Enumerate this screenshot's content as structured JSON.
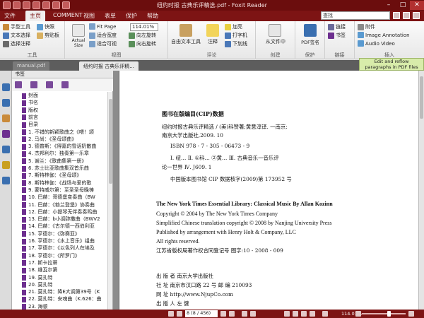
{
  "window": {
    "title": "纽约时报 古典乐评精选.pdf - Foxit Reader",
    "minimize": "–",
    "maximize": "□",
    "close": "✕"
  },
  "menu": {
    "items": [
      "文件",
      "主页",
      "COMMENT",
      "视图",
      "表单",
      "保护",
      "帮助"
    ],
    "active_index": 1,
    "search_placeholder": "查找"
  },
  "ribbon": {
    "tools": {
      "hand": "手型工具",
      "text_select": "文本选择",
      "snapshot": "快照",
      "clipboard": "剪贴板",
      "select_annotation": "选择注释",
      "label": "工具"
    },
    "view": {
      "actual_size": "Actual Size",
      "fit_page": "Fit Page",
      "fit_width": "适合宽度",
      "fit_visible": "适合可视",
      "zoom": "114.01%",
      "rotate_left": "向左旋转",
      "rotate_right": "向右旋转",
      "label": "视图"
    },
    "comment": {
      "typewriter": "自由文本工具",
      "note": "注释",
      "typewriter2": "打字机",
      "highlight": "加亮",
      "strikeout": "删除线",
      "underline": "下划线",
      "label": "评论"
    },
    "create": {
      "from_file": "从文件中",
      "label": "创建"
    },
    "protect": {
      "pdf_sign": "PDF签名",
      "label": "保护"
    },
    "links": {
      "link": "链接",
      "bookmark": "书签",
      "label": "链接"
    },
    "insert": {
      "attachment": "附件",
      "image_annotation": "Image Annotation",
      "audio_video": "Audio Video",
      "label": "插入"
    }
  },
  "doc_tabs": [
    "manual.pdf",
    "纽约时报 古典乐评精..."
  ],
  "tooltip": {
    "line1": "Edit and reflow",
    "line2": "paragraphs in PDF files"
  },
  "bookmarks": {
    "header": "书签",
    "items": [
      "封面",
      "书名",
      "版权",
      "前言",
      "目录",
      "1. 不错的新颖歌曲之《喂！颂",
      "2. 马尚：《圣母颂曲》",
      "3. 德普斯：《得嘉的雪话奶散曲",
      "4. 杰邦利尔：独奏第一乐章",
      "5. 谢兰：《歌曲集第一册》",
      "6. 苏士比亚歌曲集双首乐曲",
      "7. 斯特林伽：《圣母颂》",
      "8. 斯特林伽：《战场与爱的歌",
      "9. 蒙特威尔第：至圣圣母晚祷",
      "10. 巴赫：哥德堡变奏曲（BW",
      "11. 巴赫：《勃兰登堡》协奏曲",
      "12. 巴赫：小提琴无伴奏奏鸣曲",
      "13. 巴赫：b小调弥撒曲（BWV2",
      "14. 巴赫：《古尔德一西伯利亚",
      "15. 亨德尔：《弥赛亚》",
      "16. 亨德尔：《水上音乐》组曲",
      "17. 亨德尔：《以色列人在埃及",
      "18. 亨德尔：《所罗门》",
      "17. 斯卡拉蒂",
      "18. 维瓦尔第",
      "19. 莫扎特",
      "20. 莫扎特",
      "21. 莫扎特：降E大调第39号（K",
      "22. 莫扎特：安魂曲（K.626：曲",
      "23. 海顿"
    ]
  },
  "document": {
    "cip_title": "图书在版编目(CIP)数据",
    "cip_lines": [
      "纽约时报古典乐评精选 / (美)科赞著;黄意淳译. 一南京:",
      "南京大学出版社,2009. 10",
      "ISBN 978 - 7 - 305 - 06473 - 9",
      "Ⅰ. 纽…  Ⅱ. ①科…   ②黄…   Ⅲ. 古典音乐一音乐评",
      "论一世界  Ⅳ. J609. 1",
      "中国版本图书馆 CIP 数据核字(2009)第 173952 号"
    ],
    "en_lines": [
      "The New York Times Essential Library: Classical Music By Allan Kozinn",
      "Copyright © 2004 by The New York Times Company",
      "Simplified Chinese translation copyright © 2008 by Nanjing University Press",
      "Published by arrangement with Henry Holt & Company, LLC",
      "All rights reserved.",
      "江苏省版权局著作权合同登记号   图字:10 - 2008 - 009"
    ],
    "pub_lines": [
      "出   版   者    南京大学出版社",
      "社        址    南京市汉口路 22 号          邮   编   210093",
      "网        址    http://www.NjupCo.com",
      "出 版 人    左    健"
    ]
  },
  "status": {
    "page_field": "8 (8 / 456)",
    "zoom": "114.01%"
  },
  "colors": {
    "titlebar": "#6b0d0d",
    "menubar": "#7d1414",
    "bookmark_icon": "#6d2f8f"
  }
}
